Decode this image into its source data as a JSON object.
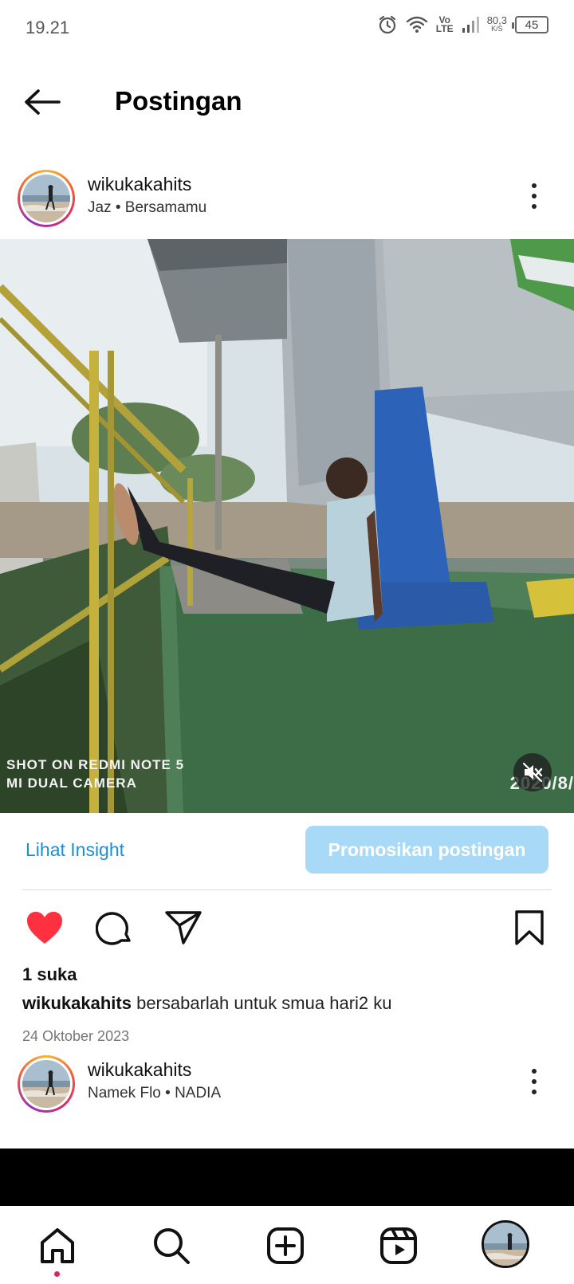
{
  "status_bar": {
    "time": "19.21",
    "volte": "Vo LTE",
    "net_speed_value": "80,3",
    "net_speed_unit": "K/S",
    "battery": "45"
  },
  "header": {
    "title": "Postingan"
  },
  "posts": [
    {
      "username": "wikukakahits",
      "music": "Jaz • Bersamamu",
      "photo_watermark_line1": "SHOT ON REDMI NOTE 5",
      "photo_watermark_line2": "MI DUAL CAMERA",
      "photo_datestamp": "2020/8/"
    },
    {
      "username": "wikukakahits",
      "music": "Namek Flo • NADIA"
    }
  ],
  "insight": {
    "link_label": "Lihat Insight",
    "promote_label": "Promosikan postingan"
  },
  "post_meta": {
    "likes": "1 suka",
    "caption_user": "wikukakahits",
    "caption_text": "bersabarlah untuk smua hari2 ku",
    "date": "24 Oktober 2023",
    "liked": true
  },
  "colors": {
    "like_red": "#ff3040",
    "link_blue": "#1a8fd6",
    "promote_bg": "#a8d9f7",
    "notification_dot": "#e0245e"
  },
  "nav": {
    "items": [
      "home-icon",
      "search-icon",
      "create-icon",
      "reels-icon",
      "profile-avatar"
    ],
    "active": "home-icon"
  }
}
